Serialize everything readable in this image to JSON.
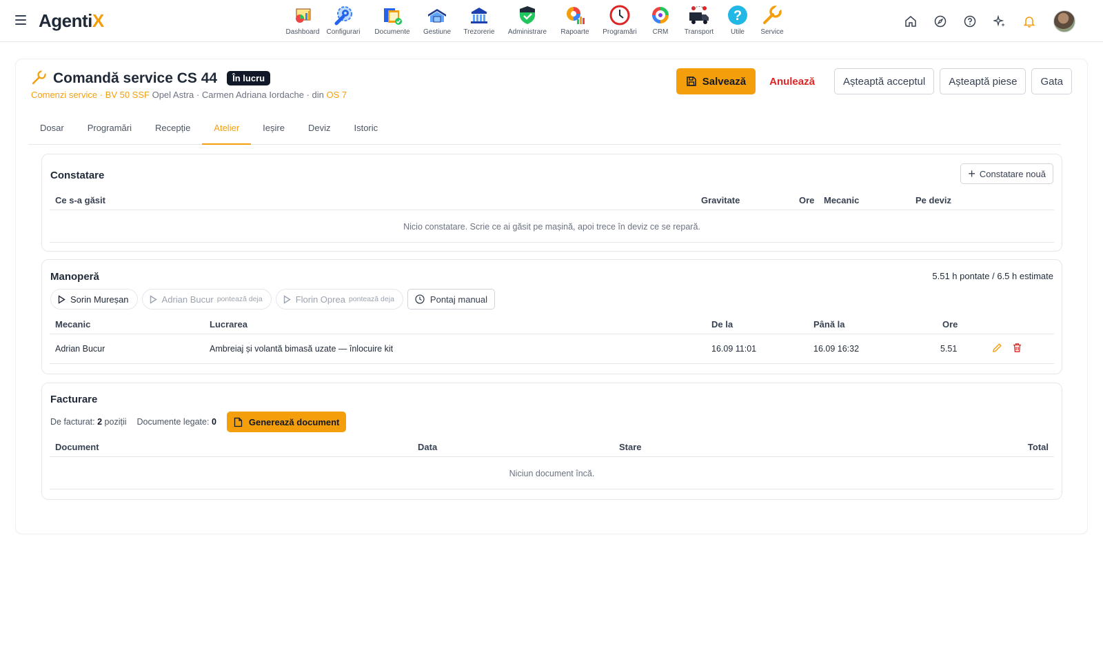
{
  "app": {
    "logo_main": "Agenti",
    "logo_accent": "X"
  },
  "modules": [
    {
      "label": "Dashboard",
      "icon": "dashboard-icon"
    },
    {
      "label": "Configurari",
      "icon": "wrench-gear-icon"
    },
    {
      "label": "Documente",
      "icon": "documents-icon"
    },
    {
      "label": "Gestiune",
      "icon": "warehouse-icon"
    },
    {
      "label": "Trezorerie",
      "icon": "bank-icon"
    },
    {
      "label": "Administrare",
      "icon": "shield-icon"
    },
    {
      "label": "Rapoarte",
      "icon": "pie-report-icon"
    },
    {
      "label": "Programări",
      "icon": "clock-icon"
    },
    {
      "label": "CRM",
      "icon": "crm-cycle-icon"
    },
    {
      "label": "Transport",
      "icon": "truck-icon"
    },
    {
      "label": "Utile",
      "icon": "help-icon"
    },
    {
      "label": "Service",
      "icon": "wrench-icon"
    }
  ],
  "header_icons": [
    "home-icon",
    "compass-icon",
    "help-circle-icon",
    "sparkles-icon",
    "bell-icon"
  ],
  "page": {
    "title": "Comandă service CS 44",
    "status": "În lucru",
    "breadcrumb": {
      "link1": "Comenzi service",
      "sep1": " · ",
      "link2": "BV 50 SSF",
      "text": " Opel Astra · Carmen Adriana Iordache · din ",
      "link3": "OS 7"
    }
  },
  "actions": {
    "save": "Salvează",
    "cancel": "Anulează",
    "wait_accept": "Așteaptă acceptul",
    "wait_parts": "Așteaptă piese",
    "done": "Gata"
  },
  "tabs": [
    {
      "label": "Dosar"
    },
    {
      "label": "Programări"
    },
    {
      "label": "Recepție"
    },
    {
      "label": "Atelier",
      "active": true
    },
    {
      "label": "Ieșire"
    },
    {
      "label": "Deviz"
    },
    {
      "label": "Istoric"
    }
  ],
  "constatare": {
    "title": "Constatare",
    "new_button": "Constatare nouă",
    "columns": [
      "Ce s-a găsit",
      "Gravitate",
      "Ore",
      "Mecanic",
      "Pe deviz"
    ],
    "empty": "Nicio constatare. Scrie ce ai găsit pe mașină, apoi trece în deviz ce se repară."
  },
  "manopera": {
    "title": "Manoperă",
    "summary": "5.51 h pontate / 6.5 h estimate",
    "mechanics": [
      {
        "name": "Sorin Mureșan",
        "note": "",
        "disabled": false
      },
      {
        "name": "Adrian Bucur",
        "note": "pontează deja",
        "disabled": true
      },
      {
        "name": "Florin Oprea",
        "note": "pontează deja",
        "disabled": true
      }
    ],
    "manual_button": "Pontaj manual",
    "columns": [
      "Mecanic",
      "Lucrarea",
      "De la",
      "Până la",
      "Ore"
    ],
    "rows": [
      {
        "mechanic": "Adrian Bucur",
        "work": "Ambreiaj și volantă bimasă uzate — înlocuire kit",
        "from": "16.09 11:01",
        "to": "16.09 16:32",
        "hours": "5.51"
      }
    ]
  },
  "facturare": {
    "title": "Facturare",
    "to_invoice_label": "De facturat:",
    "to_invoice_value": "2",
    "to_invoice_unit": "poziții",
    "linked_label": "Documente legate:",
    "linked_value": "0",
    "generate_button": "Generează document",
    "columns": [
      "Document",
      "Data",
      "Stare",
      "Total"
    ],
    "empty": "Niciun document încă."
  },
  "colors": {
    "accent": "#f59e0b",
    "danger": "#dc2626",
    "dark": "#111827"
  }
}
